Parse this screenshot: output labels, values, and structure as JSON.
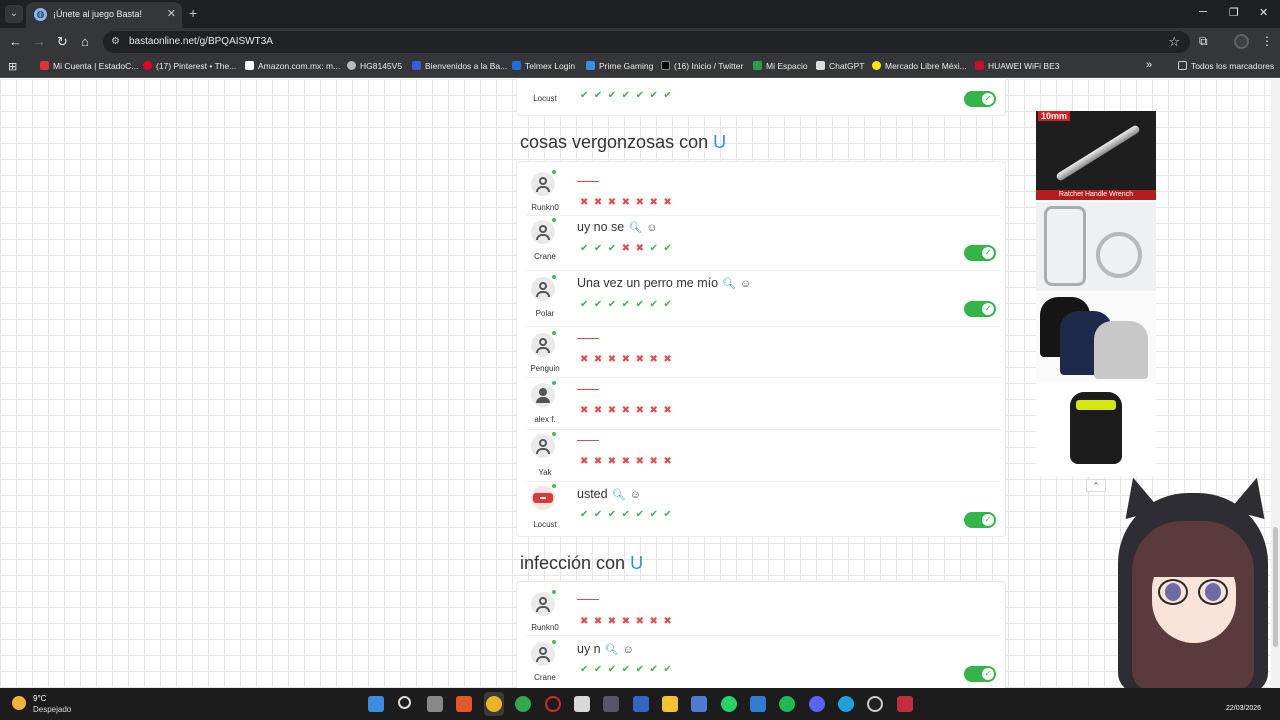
{
  "browser": {
    "tab_title": "¡Únete al juego Basta!",
    "url": "bastaonline.net/g/BPQAISWT3A",
    "bookmarks": [
      "Mi Cuenta | EstadoC...",
      "(17) Pinterest • The...",
      "Amazon.com.mx: m...",
      "HG8145V5",
      "Bienvenidos a la Ba...",
      "Telmex Login",
      "Prime Gaming",
      "(16) Inicio / Twitter",
      "Mi Espacio",
      "ChatGPT",
      "Mercado Libre Méxi...",
      "HUAWEI WiFi BE3"
    ],
    "all_bookmarks": "Todos los marcadores"
  },
  "colors": {
    "accent_letter": "#2f8fe0",
    "ok_green": "#3cb54a",
    "no_red": "#e34a4a",
    "toggle_green": "#35b44a"
  },
  "top_partial": {
    "user": "Locust",
    "votes": [
      "ok",
      "ok",
      "ok",
      "ok",
      "ok",
      "ok",
      "ok"
    ]
  },
  "sections": [
    {
      "title_prefix": "cosas vergonzosas con",
      "letter": "U",
      "rows": [
        {
          "user": "Runkn0",
          "answer": "",
          "votes": [
            "no",
            "no",
            "no",
            "no",
            "no",
            "no",
            "no"
          ],
          "accepted": false
        },
        {
          "user": "Crane",
          "answer": "uy no se",
          "votes": [
            "ok",
            "ok",
            "ok",
            "no",
            "no",
            "ok",
            "ok"
          ],
          "accepted": true
        },
        {
          "user": "Polar",
          "answer": "Una vez un perro me mío",
          "votes": [
            "ok",
            "ok",
            "ok",
            "ok",
            "ok",
            "ok",
            "ok"
          ],
          "accepted": true
        },
        {
          "user": "Penguin",
          "answer": "",
          "votes": [
            "no",
            "no",
            "no",
            "no",
            "no",
            "no",
            "no"
          ],
          "accepted": false
        },
        {
          "user": "alex f.",
          "answer": "",
          "votes": [
            "no",
            "no",
            "no",
            "no",
            "no",
            "no",
            "no"
          ],
          "accepted": false
        },
        {
          "user": "Yak",
          "answer": "",
          "votes": [
            "no",
            "no",
            "no",
            "no",
            "no",
            "no",
            "no"
          ],
          "accepted": false
        },
        {
          "user": "Locust",
          "answer": "usted",
          "votes": [
            "ok",
            "ok",
            "ok",
            "ok",
            "ok",
            "ok",
            "ok"
          ],
          "accepted": true
        }
      ]
    },
    {
      "title_prefix": "infección con",
      "letter": "U",
      "rows": [
        {
          "user": "Runkn0",
          "answer": "",
          "votes": [
            "no",
            "no",
            "no",
            "no",
            "no",
            "no",
            "no"
          ],
          "accepted": false
        },
        {
          "user": "Crane",
          "answer": "uy n",
          "votes": [
            "ok",
            "ok",
            "ok",
            "ok",
            "ok",
            "ok",
            "ok"
          ],
          "accepted": true
        }
      ]
    }
  ],
  "ads": {
    "ad1_tag": "10mm",
    "ad1_caption": "Ratchet Handle Wrench"
  },
  "taskbar": {
    "temp": "9°C",
    "condition": "Despejado",
    "date": "22/03/2026"
  }
}
